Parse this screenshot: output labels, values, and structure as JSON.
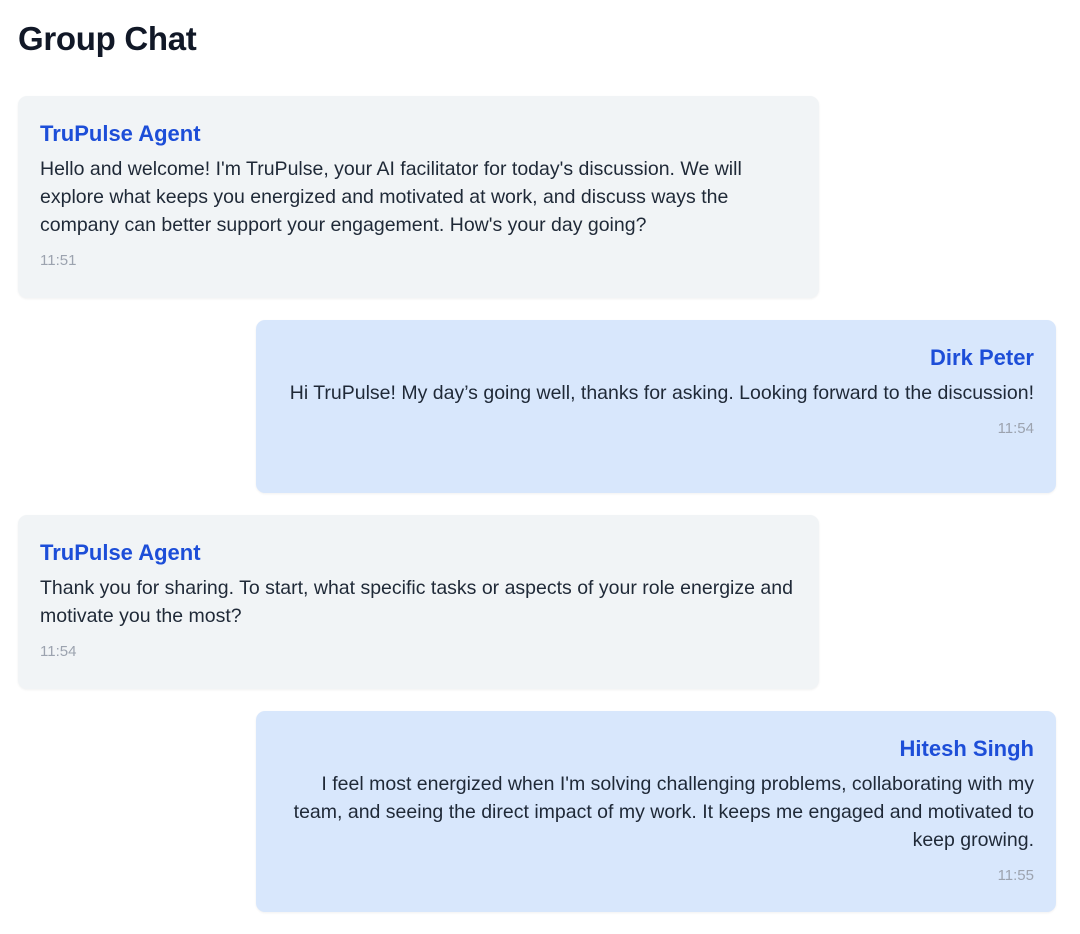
{
  "header": {
    "title": "Group Chat"
  },
  "messages": [
    {
      "sender": "TruPulse Agent",
      "text": "Hello and welcome! I'm TruPulse, your AI facilitator for today's discussion. We will explore what keeps you energized and motivated at work, and discuss ways the company can better support your engagement. How's your day going?",
      "time": "11:51",
      "side": "agent"
    },
    {
      "sender": "Dirk Peter",
      "text": "Hi TruPulse! My day’s going well, thanks for asking. Looking forward to the discussion!",
      "time": "11:54",
      "side": "user"
    },
    {
      "sender": "TruPulse Agent",
      "text": "Thank you for sharing. To start, what specific tasks or aspects of your role energize and motivate you the most?",
      "time": "11:54",
      "side": "agent"
    },
    {
      "sender": "Hitesh Singh",
      "text": "I feel most energized when I'm solving challenging problems, collaborating with my team, and seeing the direct impact of my work. It keeps me engaged and motivated to keep growing.",
      "time": "11:55",
      "side": "user"
    }
  ],
  "colors": {
    "agent_bubble": "#f1f4f6",
    "user_bubble": "#d8e7fc",
    "sender_name": "#1d4ed8",
    "timestamp": "#9ca3af"
  }
}
